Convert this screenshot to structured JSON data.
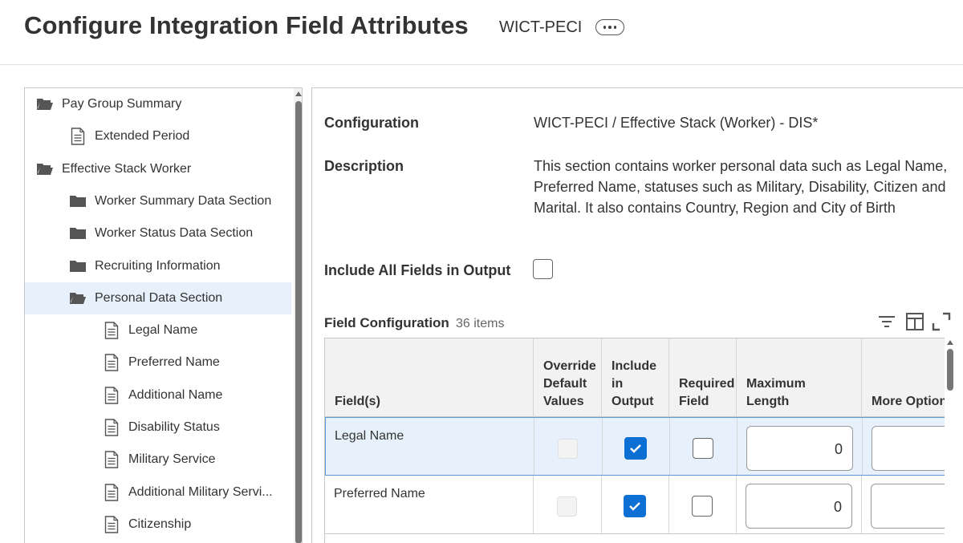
{
  "header": {
    "title": "Configure Integration Field Attributes",
    "subtitle": "WICT-PECI"
  },
  "tree": {
    "items": [
      {
        "label": "Pay Group Summary",
        "icon": "folder-open-icon"
      },
      {
        "label": "Extended Period",
        "icon": "document-icon"
      },
      {
        "label": "Effective Stack Worker",
        "icon": "folder-open-icon"
      },
      {
        "label": "Worker Summary Data Section",
        "icon": "folder-icon"
      },
      {
        "label": "Worker Status Data Section",
        "icon": "folder-icon"
      },
      {
        "label": "Recruiting Information",
        "icon": "folder-icon"
      },
      {
        "label": "Personal Data Section",
        "icon": "folder-open-icon",
        "selected": true
      },
      {
        "label": "Legal Name",
        "icon": "document-icon"
      },
      {
        "label": "Preferred Name",
        "icon": "document-icon"
      },
      {
        "label": "Additional Name",
        "icon": "document-icon"
      },
      {
        "label": "Disability Status",
        "icon": "document-icon"
      },
      {
        "label": "Military Service",
        "icon": "document-icon"
      },
      {
        "label": "Additional Military Servi...",
        "icon": "document-icon"
      },
      {
        "label": "Citizenship",
        "icon": "document-icon"
      }
    ]
  },
  "detail": {
    "configuration_label": "Configuration",
    "configuration_value": "WICT-PECI / Effective Stack (Worker) - DIS*",
    "description_label": "Description",
    "description_value": "This section contains worker personal data such as Legal Name, Preferred Name, statuses such as Military, Disability, Citizen and Marital. It also contains Country, Region and City of Birth",
    "include_all_label": "Include All Fields in Output",
    "include_all_checked": false
  },
  "field_config": {
    "title": "Field Configuration",
    "count": "36 items",
    "toolbar_icons": [
      "filter-icon",
      "columns-icon",
      "expand-icon"
    ],
    "columns": {
      "field": "Field(s)",
      "override_1": "Override",
      "override_2": "Default",
      "override_3": "Values",
      "include_1": "Include",
      "include_2": "in",
      "include_3": "Output",
      "required_1": "Required",
      "required_2": "Field",
      "max_length": "Maximum Length",
      "more_options": "More Option"
    },
    "rows": [
      {
        "field": "Legal Name",
        "override": false,
        "include": true,
        "required": false,
        "max_length": "0",
        "selected": true
      },
      {
        "field": "Preferred Name",
        "override": false,
        "include": true,
        "required": false,
        "max_length": "0",
        "selected": false
      }
    ]
  },
  "colors": {
    "accent": "#0b6fd4",
    "selected_bg": "#e6f1fb",
    "selected_border": "#5b9bd5"
  }
}
